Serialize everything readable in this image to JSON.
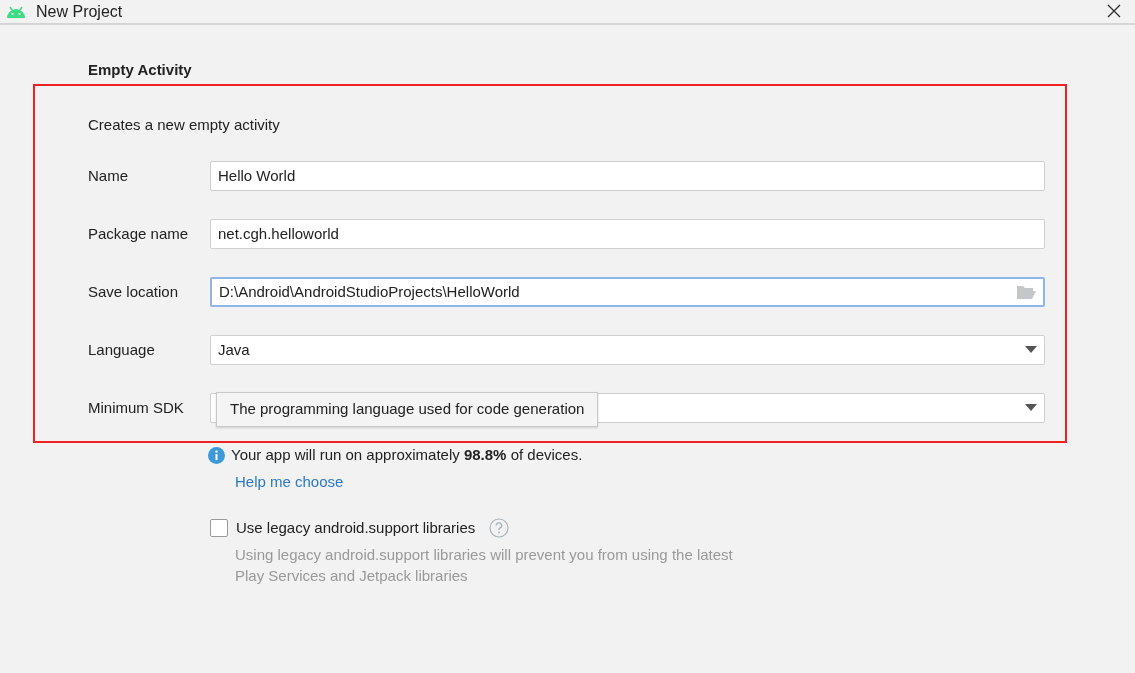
{
  "window": {
    "title": "New Project"
  },
  "heading": "Empty Activity",
  "description": "Creates a new empty activity",
  "fields": [
    {
      "kind": "text",
      "label": "Name",
      "value": "Hello World",
      "focused": false
    },
    {
      "kind": "text",
      "label": "Package name",
      "value": "net.cgh.helloworld",
      "focused": false
    },
    {
      "kind": "folder",
      "label": "Save location",
      "value": "D:\\Android\\AndroidStudioProjects\\HelloWorld",
      "focused": true
    },
    {
      "kind": "dropdown",
      "label": "Language",
      "value": "Java",
      "focused": false
    },
    {
      "kind": "dropdown",
      "label": "Minimum SDK",
      "focused": false
    }
  ],
  "tooltip": "The programming language used for code generation",
  "info": "Your app will run on approximately **98.8%** of devices.",
  "help_link": "Help me choose",
  "legacy": {
    "label": "Use legacy android.support libraries",
    "checked": false,
    "note": "Using legacy android.support libraries will prevent you from using the latest Play Services and Jetpack libraries"
  },
  "annotation": {
    "kind": "frame",
    "color": "#ee2222"
  }
}
